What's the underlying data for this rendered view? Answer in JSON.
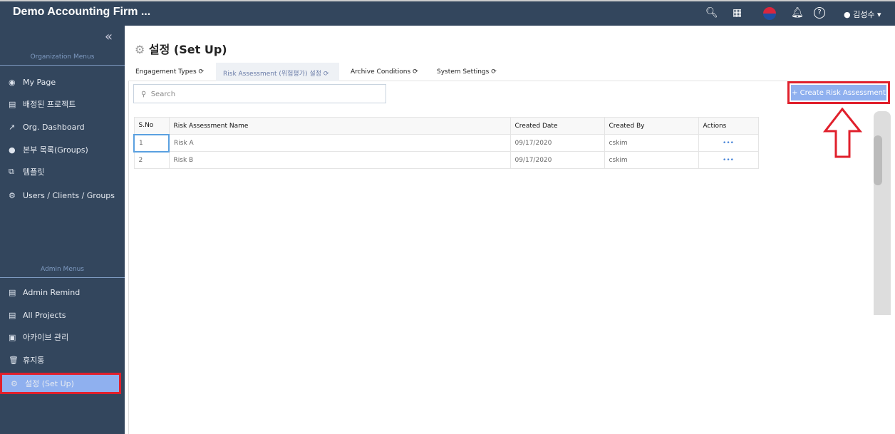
{
  "header": {
    "brand": "Demo Accounting Firm ...",
    "user": "김성수"
  },
  "sidebar": {
    "org_title": "Organization Menus",
    "org_items": [
      {
        "label": "My Page",
        "icon": "user-circle-icon"
      },
      {
        "label": "배정된 프로젝트",
        "icon": "project-icon"
      },
      {
        "label": "Org. Dashboard",
        "icon": "chart-icon"
      },
      {
        "label": "본부 목록(Groups)",
        "icon": "group-icon"
      },
      {
        "label": "템플릿",
        "icon": "template-icon"
      },
      {
        "label": "Users / Clients / Groups",
        "icon": "gear-icon"
      }
    ],
    "admin_title": "Admin Menus",
    "admin_items": [
      {
        "label": "Admin Remind",
        "icon": "project-icon"
      },
      {
        "label": "All Projects",
        "icon": "project-icon"
      },
      {
        "label": "아카이브 관리",
        "icon": "archive-icon"
      },
      {
        "label": "휴지통",
        "icon": "trash-icon"
      },
      {
        "label": "설정 (Set Up)",
        "icon": "gear-icon"
      }
    ]
  },
  "page": {
    "title": "설정 (Set Up)"
  },
  "tabs": [
    {
      "label": "Engagement Types"
    },
    {
      "label": "Risk Assessment (위험평가) 설정"
    },
    {
      "label": "Archive Conditions"
    },
    {
      "label": "System Settings"
    }
  ],
  "search": {
    "placeholder": "Search"
  },
  "create_label": "+ Create Risk Assessment",
  "table": {
    "headers": [
      "S.No",
      "Risk Assessment Name",
      "Created Date",
      "Created By",
      "Actions"
    ],
    "rows": [
      [
        "1",
        "Risk A",
        "09/17/2020",
        "cskim",
        "•••"
      ],
      [
        "2",
        "Risk B",
        "09/17/2020",
        "cskim",
        "•••"
      ]
    ]
  },
  "colors": {
    "header_bg": "#33465d",
    "accent": "#8fb0ef",
    "highlight": "#e0202c"
  }
}
